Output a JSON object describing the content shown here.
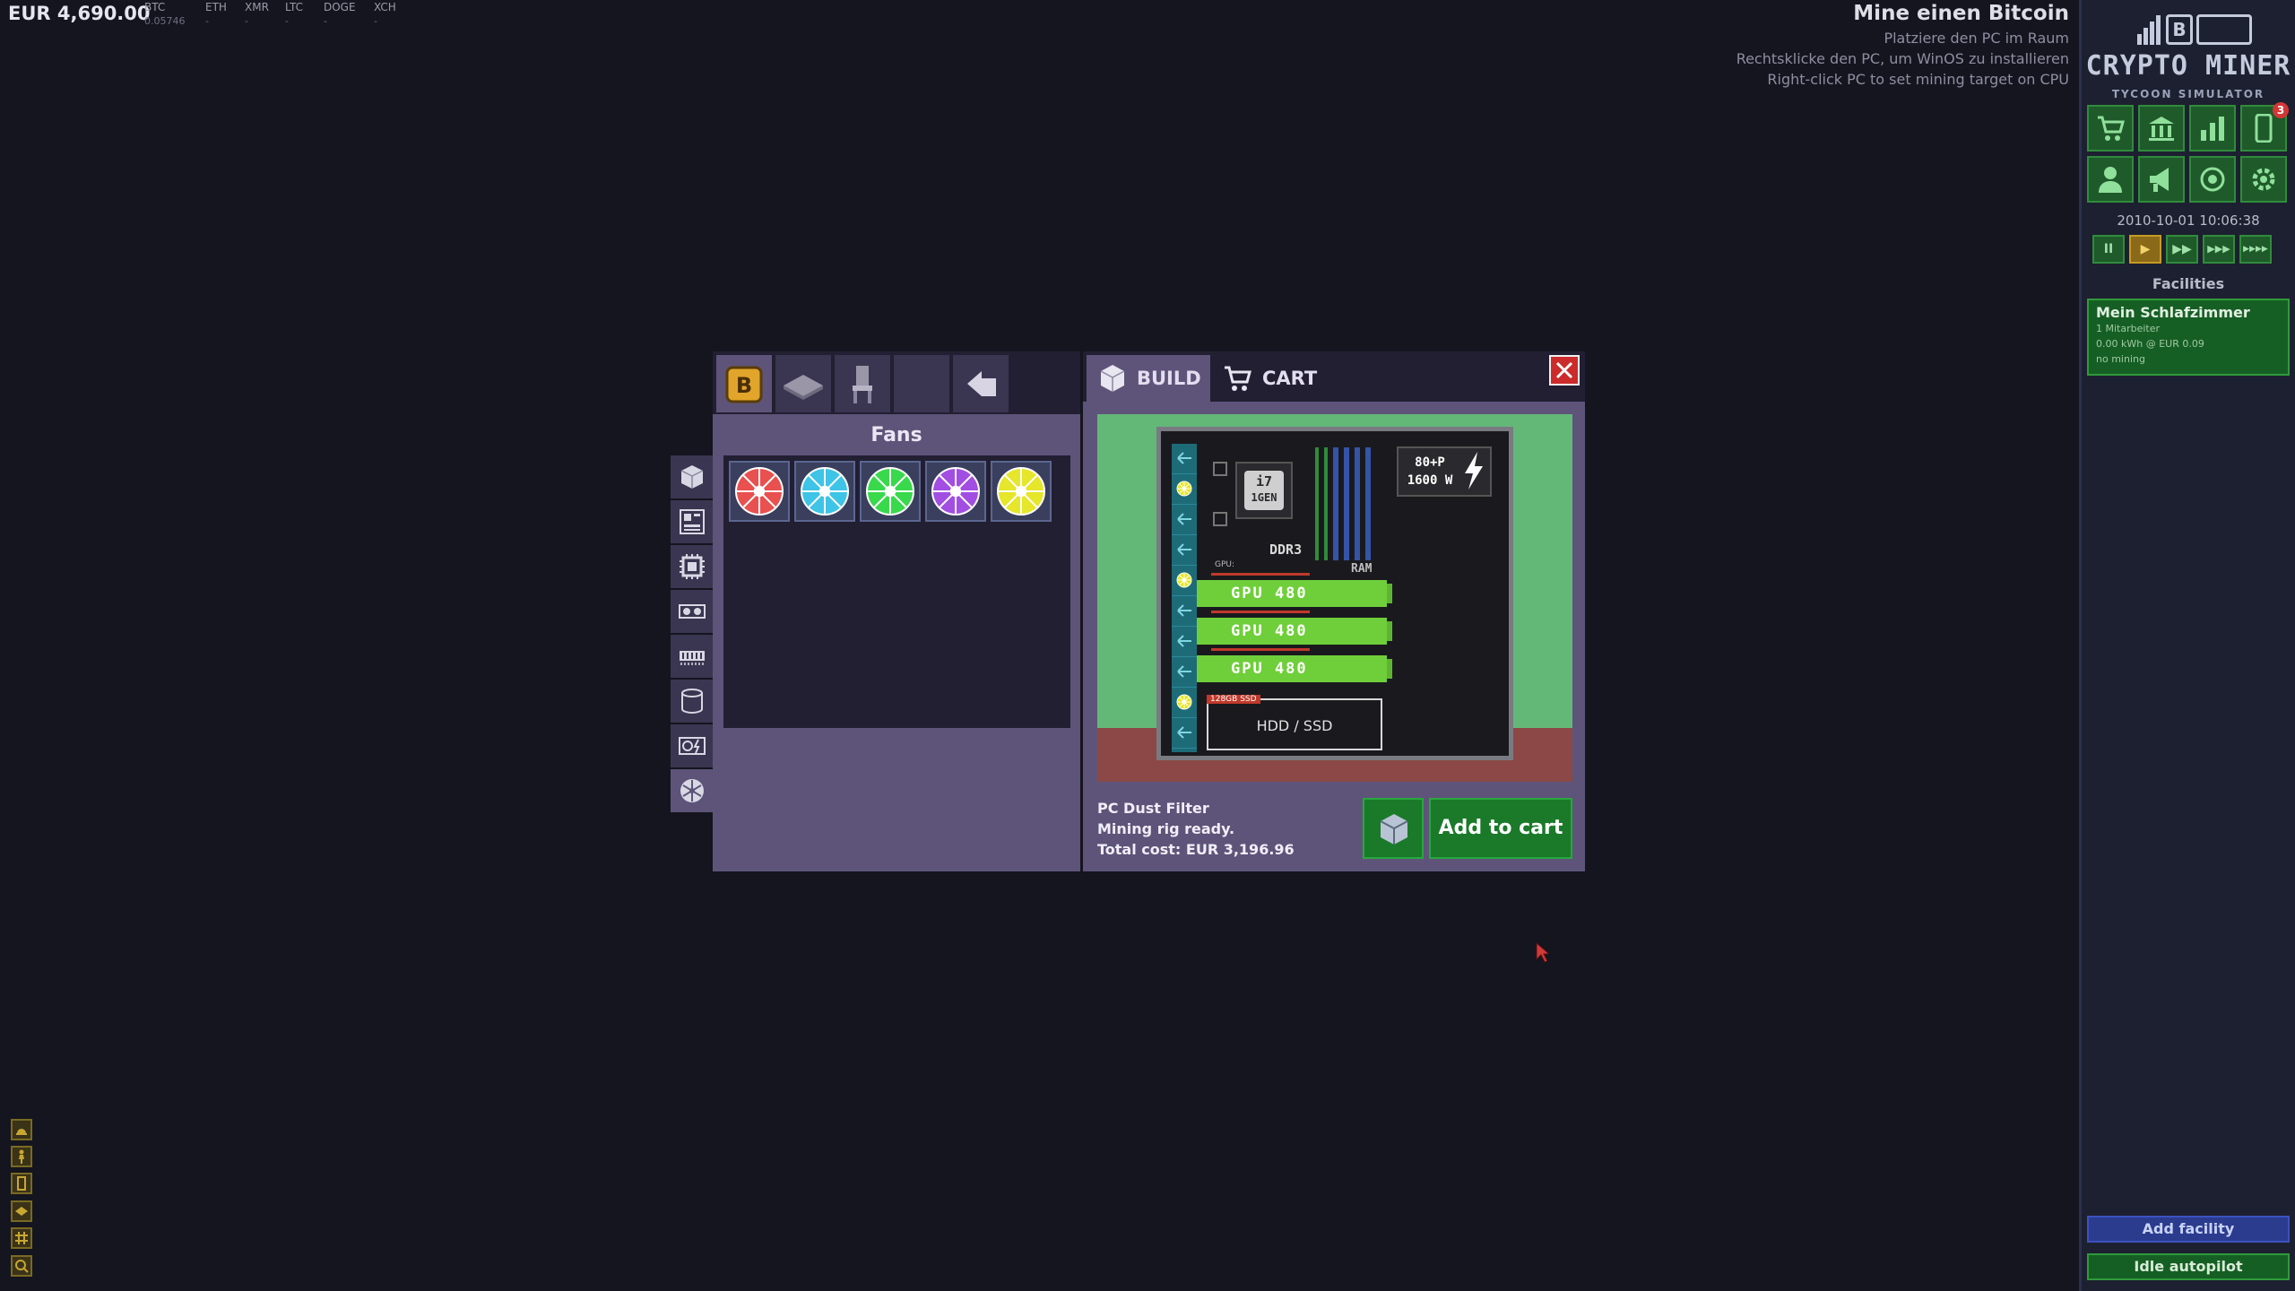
{
  "hud": {
    "money": "EUR 4,690.00",
    "coins": [
      {
        "symbol": "BTC",
        "value": "0.05746"
      },
      {
        "symbol": "ETH",
        "value": "-"
      },
      {
        "symbol": "XMR",
        "value": "-"
      },
      {
        "symbol": "LTC",
        "value": "-"
      },
      {
        "symbol": "DOGE",
        "value": "-"
      },
      {
        "symbol": "XCH",
        "value": "-"
      }
    ]
  },
  "objective": {
    "title": "Mine einen Bitcoin",
    "lines": [
      "Platziere den PC im Raum",
      "Rechtsklicke den PC, um WinOS zu installieren",
      "Right-click PC to set mining target on CPU"
    ]
  },
  "sidebar": {
    "logo_title": "CRYPTO MINER",
    "logo_subtitle": "TYCOON SIMULATOR",
    "logo_coin_letter": "B",
    "nav_row1": [
      "shop-icon",
      "bank-icon",
      "chart-icon",
      "phone-icon"
    ],
    "nav_row2": [
      "user-icon",
      "megaphone-icon",
      "target-icon",
      "gear-icon"
    ],
    "phone_badge": "3",
    "datetime": "2010-10-01 10:06:38",
    "speeds": [
      "II",
      "▶",
      "▶▶",
      "▶▶▶",
      "▶▶▶▶"
    ],
    "active_speed": 1,
    "facilities_header": "Facilities",
    "facility": {
      "name": "Mein Schlafzimmer",
      "lines": [
        "1 Mitarbeiter",
        "0.00 kWh @ EUR 0.09",
        "no mining"
      ]
    },
    "add_facility": "Add facility",
    "idle_autopilot": "Idle autopilot"
  },
  "shop": {
    "category_title": "Fans",
    "top_tabs": [
      "bitcoin-icon",
      "floor-icon",
      "chair-icon",
      "empty-slot",
      "back-arrow-icon"
    ],
    "side_tabs": [
      "case-icon",
      "motherboard-icon",
      "cpu-icon",
      "gpu-icon",
      "ram-icon",
      "storage-icon",
      "psu-icon",
      "fan-icon"
    ],
    "fans": [
      {
        "name": "red-fan",
        "color": "#e8514f"
      },
      {
        "name": "cyan-fan",
        "color": "#3ec4e6"
      },
      {
        "name": "green-fan",
        "color": "#39d94c"
      },
      {
        "name": "purple-fan",
        "color": "#a34ee3"
      },
      {
        "name": "yellow-fan",
        "color": "#e6e62a"
      }
    ]
  },
  "build": {
    "tab_build": "BUILD",
    "tab_cart": "CART",
    "pc": {
      "cpu_line1": "i7",
      "cpu_line2": "1GEN",
      "memory": "DDR3",
      "ram_label": "RAM",
      "gpu_slot_label": "GPU:",
      "psu_rating_line1": "80+P",
      "psu_rating_line2": "1600 W",
      "gpus": [
        "GPU 480",
        "GPU 480",
        "GPU 480"
      ],
      "ssd": "128GB SSD",
      "storage": "HDD / SSD"
    },
    "info_lines": [
      "PC Dust Filter",
      "Mining rig ready.",
      "Total cost: EUR 3,196.96"
    ],
    "add_to_cart": "Add to cart"
  },
  "colors": {
    "accent_green": "#1a7a2a",
    "panel_purple": "#5e5479",
    "gpu_green": "#6fcf3a",
    "close_red": "#cc2b2b"
  }
}
